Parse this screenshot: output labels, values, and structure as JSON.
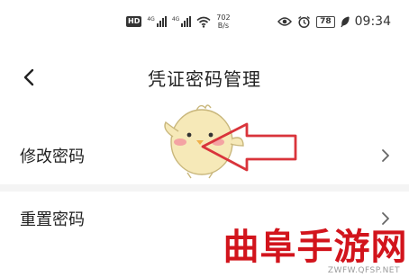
{
  "status_bar": {
    "hd_badge": "HD",
    "signal1_label": "4G",
    "signal2_label": "4G",
    "net_speed_value": "702",
    "net_speed_unit": "B/s",
    "battery": "78",
    "time": "09:34",
    "icons": [
      "hd-icon",
      "signal-icon",
      "signal-icon",
      "wifi-icon",
      "eye-icon",
      "alarm-icon",
      "battery-icon",
      "leaf-icon"
    ]
  },
  "header": {
    "title": "凭证密码管理",
    "back_icon": "chevron-left-icon"
  },
  "list": [
    {
      "label": "修改密码",
      "icon": "chevron-right-icon"
    },
    {
      "label": "重置密码",
      "icon": "chevron-right-icon"
    }
  ],
  "overlay": {
    "mascot": "chick-mascot",
    "arrow_color": "#d9343b"
  },
  "watermark": {
    "title": "曲阜手游网",
    "url": "ZWFW.QFSP.NET",
    "color": "#d2141c"
  }
}
